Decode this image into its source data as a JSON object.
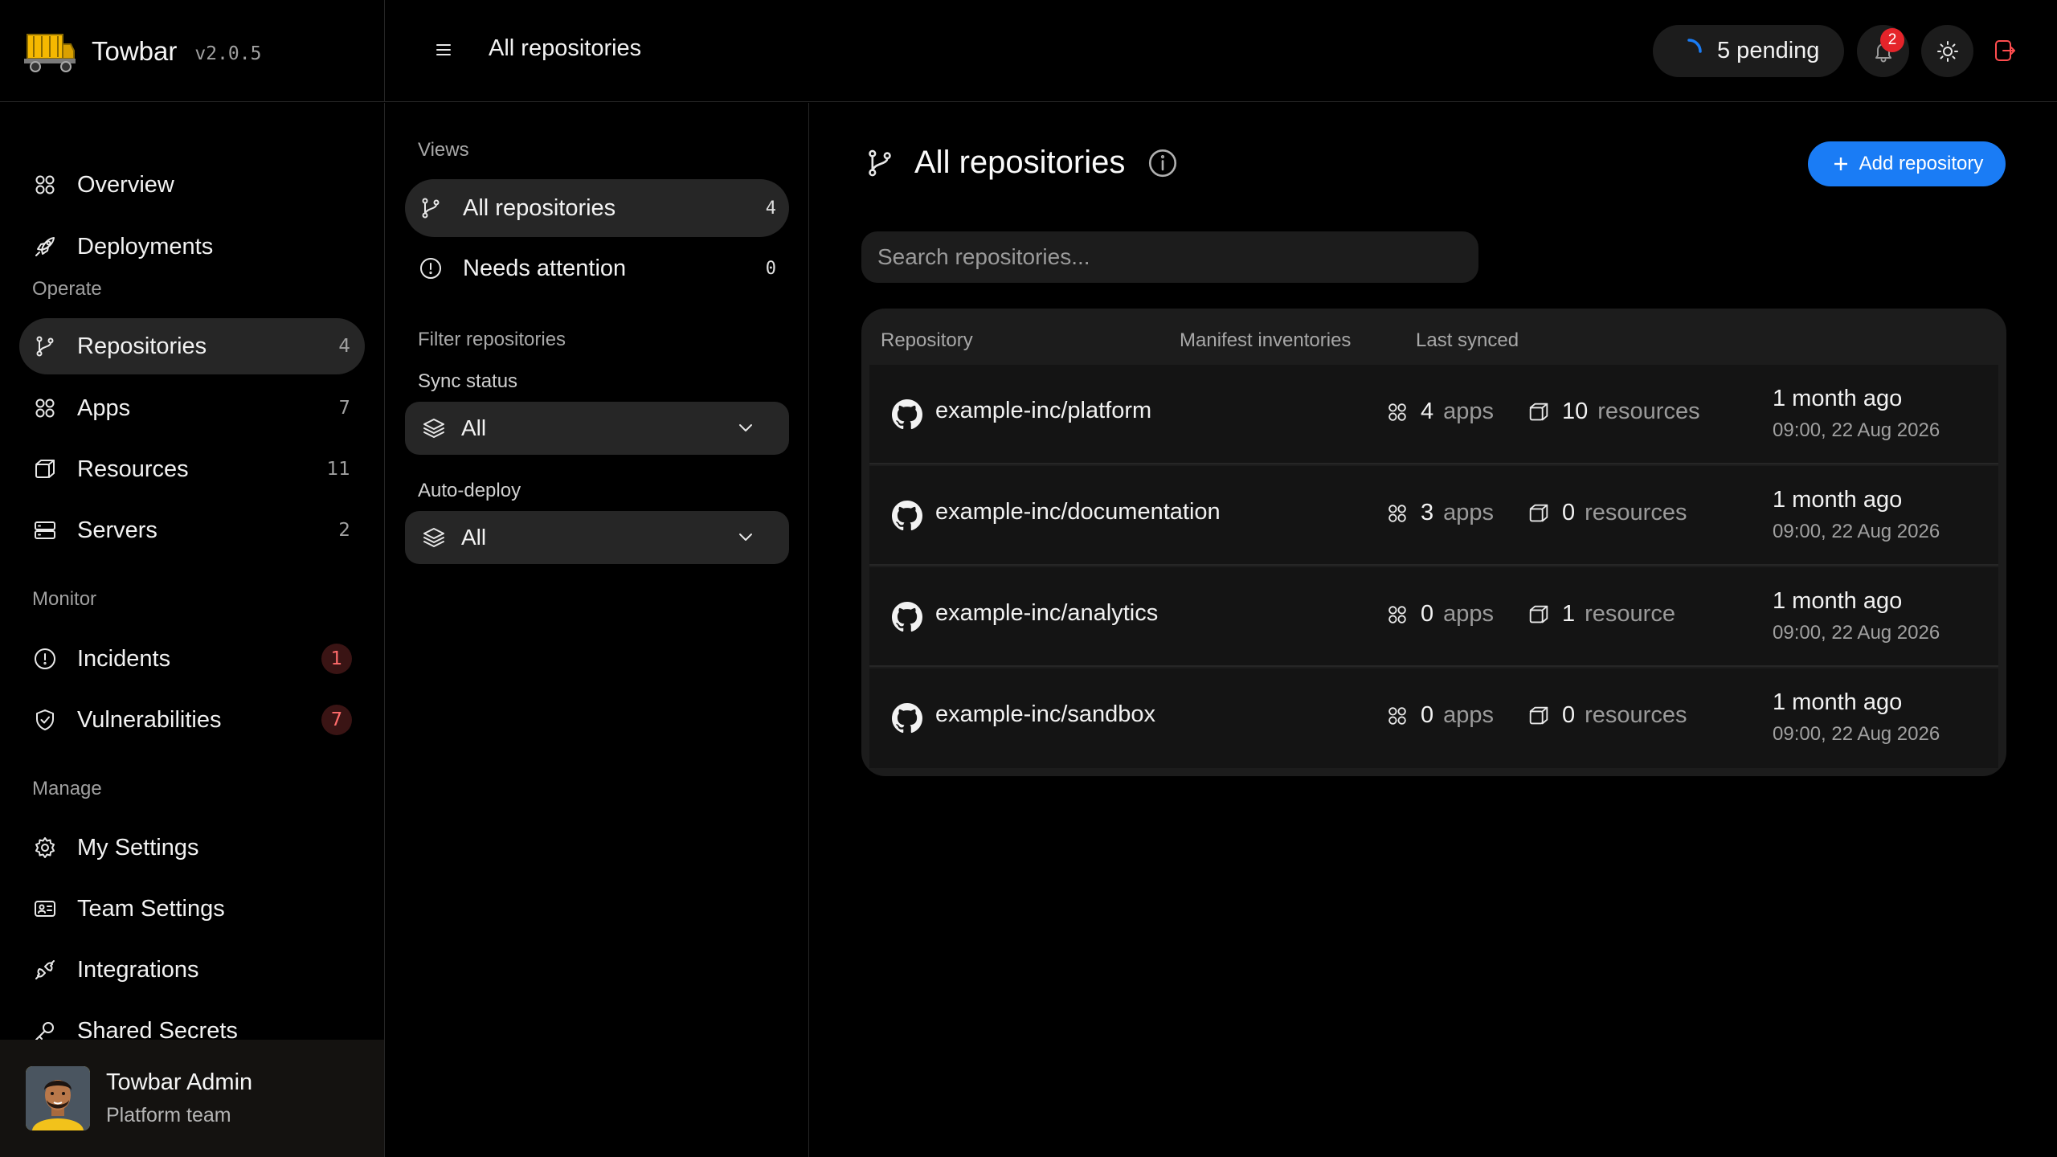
{
  "app": {
    "name": "Towbar",
    "version": "v2.0.5"
  },
  "topbar": {
    "title": "All repositories",
    "pending_label": "5 pending",
    "notification_count": "2"
  },
  "sidebar": {
    "main_items": [
      {
        "label": "Overview",
        "icon": "grid-icon"
      },
      {
        "label": "Deployments",
        "icon": "rocket-icon"
      }
    ],
    "sections": [
      {
        "title": "Operate",
        "items": [
          {
            "label": "Repositories",
            "count": "4",
            "icon": "git-branch-icon",
            "active": true
          },
          {
            "label": "Apps",
            "count": "7",
            "icon": "grid-icon"
          },
          {
            "label": "Resources",
            "count": "11",
            "icon": "cube-icon"
          },
          {
            "label": "Servers",
            "count": "2",
            "icon": "server-icon"
          }
        ]
      },
      {
        "title": "Monitor",
        "items": [
          {
            "label": "Incidents",
            "count": "1",
            "icon": "alert-circle-icon",
            "alert": true
          },
          {
            "label": "Vulnerabilities",
            "count": "7",
            "icon": "shield-check-icon",
            "alert": true
          }
        ]
      },
      {
        "title": "Manage",
        "items": [
          {
            "label": "My Settings",
            "icon": "gear-icon"
          },
          {
            "label": "Team Settings",
            "icon": "id-card-icon"
          },
          {
            "label": "Integrations",
            "icon": "plug-icon"
          },
          {
            "label": "Shared Secrets",
            "icon": "key-icon"
          }
        ]
      }
    ],
    "user": {
      "name": "Towbar Admin",
      "team": "Platform team"
    }
  },
  "views": {
    "heading": "Views",
    "items": [
      {
        "label": "All repositories",
        "count": "4",
        "active": true
      },
      {
        "label": "Needs attention",
        "count": "0"
      }
    ],
    "filter_heading": "Filter repositories",
    "filters": [
      {
        "label": "Sync status",
        "value": "All"
      },
      {
        "label": "Auto-deploy",
        "value": "All"
      }
    ]
  },
  "main": {
    "title": "All repositories",
    "add_button": "Add repository",
    "search_placeholder": "Search repositories...",
    "columns": [
      "Repository",
      "Manifest inventories",
      "Last synced"
    ],
    "rows": [
      {
        "repo": "example-inc/platform",
        "apps": "4",
        "apps_unit": "apps",
        "resources": "10",
        "resources_unit": "resources",
        "synced": "1 month ago",
        "timestamp": "09:00, 22 Aug 2026"
      },
      {
        "repo": "example-inc/documentation",
        "apps": "3",
        "apps_unit": "apps",
        "resources": "0",
        "resources_unit": "resources",
        "synced": "1 month ago",
        "timestamp": "09:00, 22 Aug 2026"
      },
      {
        "repo": "example-inc/analytics",
        "apps": "0",
        "apps_unit": "apps",
        "resources": "1",
        "resources_unit": "resource",
        "synced": "1 month ago",
        "timestamp": "09:00, 22 Aug 2026"
      },
      {
        "repo": "example-inc/sandbox",
        "apps": "0",
        "apps_unit": "apps",
        "resources": "0",
        "resources_unit": "resources",
        "synced": "1 month ago",
        "timestamp": "09:00, 22 Aug 2026"
      }
    ]
  },
  "colors": {
    "accent": "#1a7cf5",
    "alert": "#e5242a",
    "background": "#000000",
    "surface": "#1c1c1c"
  }
}
